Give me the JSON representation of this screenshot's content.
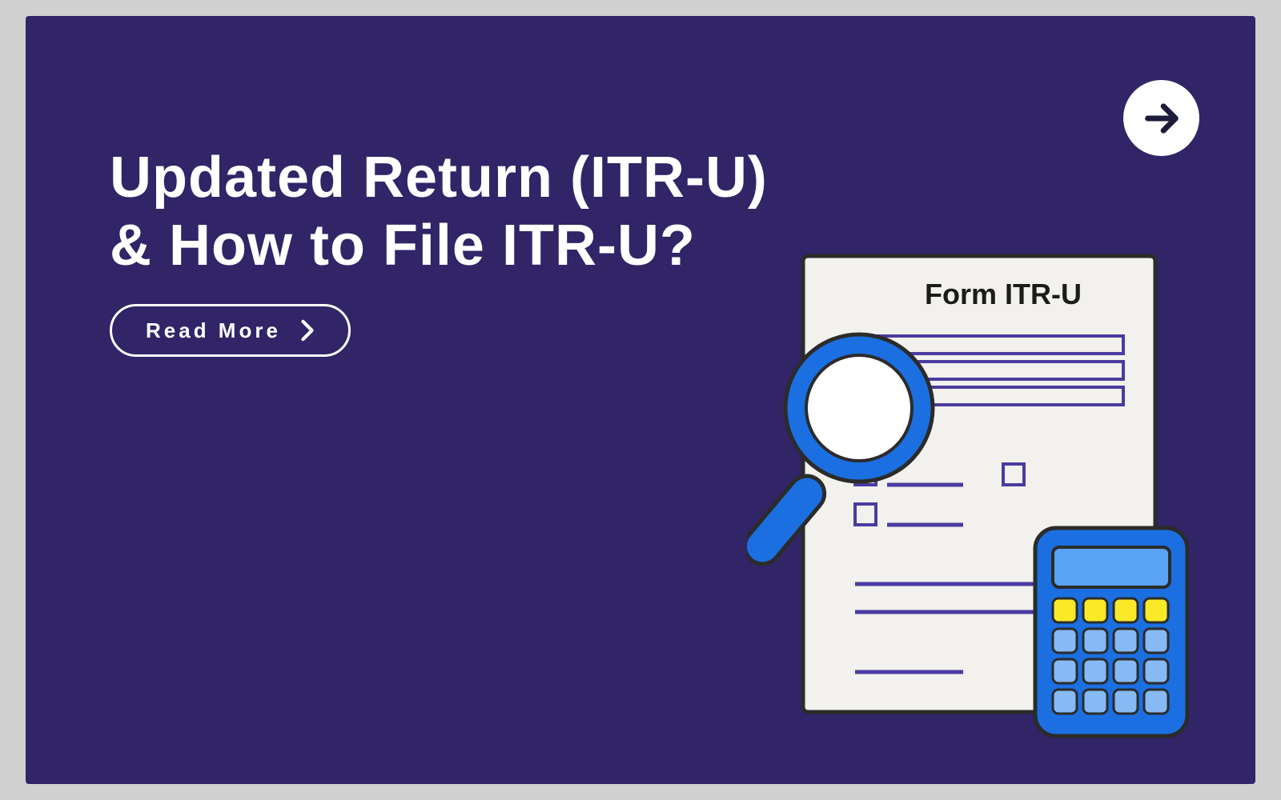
{
  "hero": {
    "title_line1": "Updated Return (ITR-U)",
    "title_line2": "& How to File ITR-U?",
    "cta_label": "Read More",
    "form_heading": "Form ITR-U"
  },
  "icons": {
    "next": "arrow-right-icon",
    "cta_chevron": "chevron-right-icon"
  },
  "colors": {
    "bg": "#312467",
    "accent_blue": "#1b6fe0",
    "line_purple": "#4b3ba0",
    "calc_yellow": "#f9e928",
    "calc_light": "#87b9f4"
  }
}
